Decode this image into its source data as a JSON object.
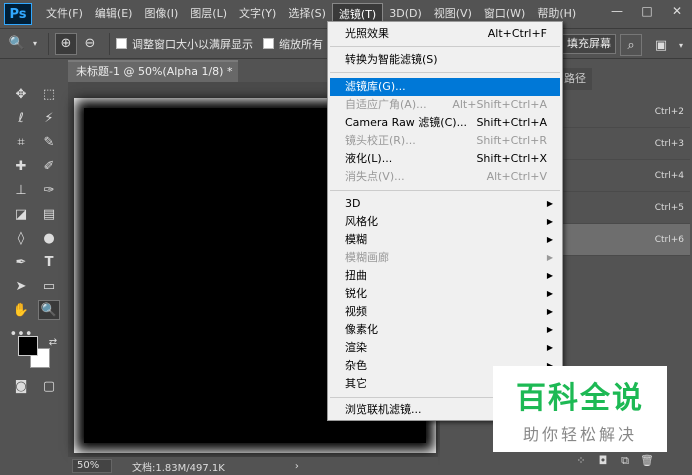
{
  "app": {
    "logo": "Ps"
  },
  "menubar": {
    "items": [
      "文件(F)",
      "编辑(E)",
      "图像(I)",
      "图层(L)",
      "文字(Y)",
      "选择(S)",
      "滤镜(T)",
      "3D(D)",
      "视图(V)",
      "窗口(W)",
      "帮助(H)"
    ],
    "active": "滤镜(T)"
  },
  "window_controls": {
    "minimize": "—",
    "maximize": "□",
    "close": "✕"
  },
  "options": {
    "resize_windows_label": "调整窗口大小以满屏显示",
    "zoom_all_label": "缩放所有",
    "fill_screen_button": "填充屏幕"
  },
  "document": {
    "tab_title": "未标题-1 @ 50%(Alpha 1/8) *"
  },
  "status": {
    "zoom": "50%",
    "doc_size": "文档:1.83M/497.1K"
  },
  "panel": {
    "tab": "路径",
    "rows": [
      {
        "shortcut": "Ctrl+2"
      },
      {
        "shortcut": "Ctrl+3"
      },
      {
        "shortcut": "Ctrl+4"
      },
      {
        "shortcut": "Ctrl+5"
      },
      {
        "shortcut": "Ctrl+6"
      }
    ]
  },
  "filter_menu": {
    "last_filter": {
      "label": "光照效果",
      "shortcut": "Alt+Ctrl+F"
    },
    "smart": {
      "label": "转换为智能滤镜(S)"
    },
    "gallery": {
      "label": "滤镜库(G)...",
      "shortcut": ""
    },
    "adaptive": {
      "label": "自适应广角(A)...",
      "shortcut": "Alt+Shift+Ctrl+A"
    },
    "camera_raw": {
      "label": "Camera Raw 滤镜(C)...",
      "shortcut": "Shift+Ctrl+A"
    },
    "lens": {
      "label": "镜头校正(R)...",
      "shortcut": "Shift+Ctrl+R"
    },
    "liquify": {
      "label": "液化(L)...",
      "shortcut": "Shift+Ctrl+X"
    },
    "vanishing": {
      "label": "消失点(V)...",
      "shortcut": "Alt+Ctrl+V"
    },
    "sub": [
      "3D",
      "风格化",
      "模糊",
      "模糊画廊",
      "扭曲",
      "锐化",
      "视频",
      "像素化",
      "渲染",
      "杂色",
      "其它"
    ],
    "browse": {
      "label": "浏览联机滤镜..."
    }
  },
  "watermark": {
    "title": "百科全说",
    "subtitle": "助你轻松解决"
  },
  "colors": {
    "highlight": "#0078d7",
    "menu_bg": "#f0f0f0",
    "ui_bg": "#535353"
  }
}
